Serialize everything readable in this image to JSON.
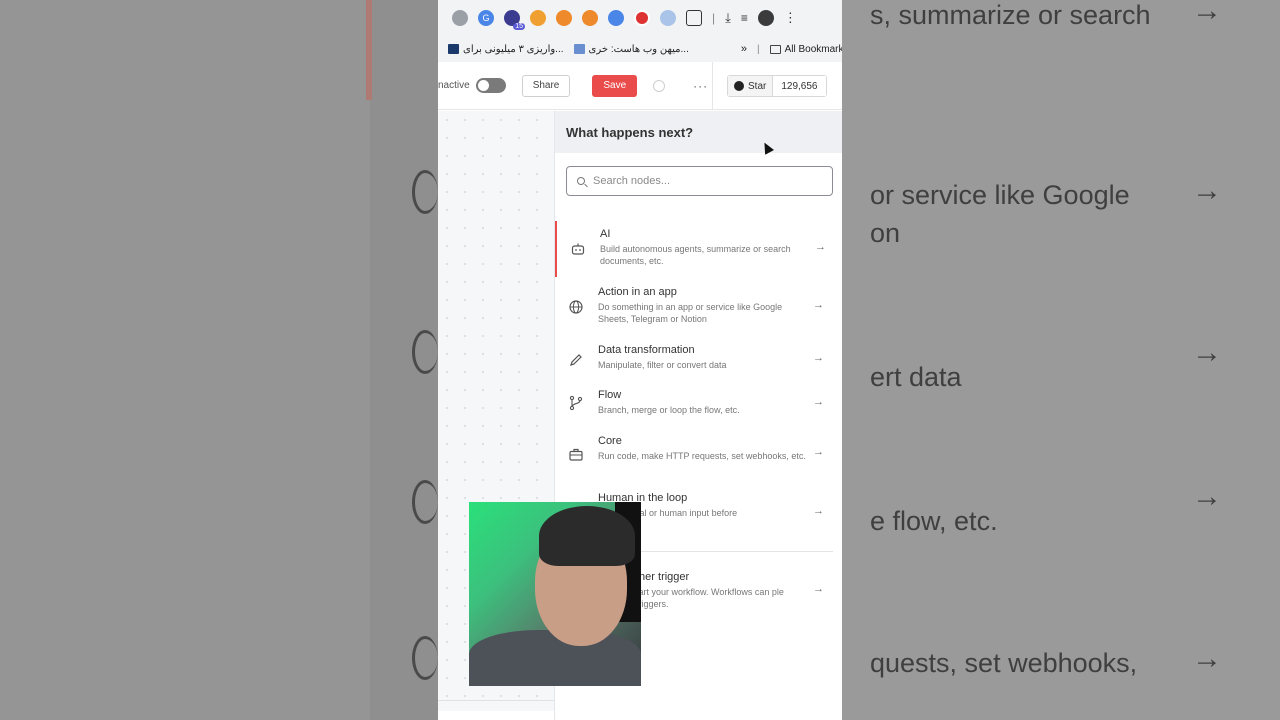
{
  "browser": {
    "extensions": [
      "camera-icon",
      "translate-icon",
      "grad-cap-icon",
      "rss-icon",
      "pocket-icon",
      "pocket-icon",
      "tool-icon",
      "globe-badge-icon",
      "shield-icon",
      "puzzle-icon"
    ],
    "ext_badge": "15",
    "bookmarks": [
      {
        "label": "واریزی ۳ میلیونی برای..."
      },
      {
        "label": "میهن وب هاست: خری..."
      }
    ],
    "more_bookmarks": "»",
    "all_bookmarks": "All Bookmarks"
  },
  "toolbar": {
    "inactive_label": "nactive",
    "share_label": "Share",
    "save_label": "Save",
    "more_label": "···",
    "github_star": "Star",
    "github_count": "129,656"
  },
  "panel": {
    "title": "What happens next?",
    "search_placeholder": "Search nodes...",
    "items": [
      {
        "title": "AI",
        "desc": "Build autonomous agents, summarize or search documents, etc.",
        "icon": "robot-icon"
      },
      {
        "title": "Action in an app",
        "desc": "Do something in an app or service like Google Sheets, Telegram or Notion",
        "icon": "globe-icon"
      },
      {
        "title": "Data transformation",
        "desc": "Manipulate, filter or convert data",
        "icon": "pencil-icon"
      },
      {
        "title": "Flow",
        "desc": "Branch, merge or loop the flow, etc.",
        "icon": "branch-icon"
      },
      {
        "title": "Core",
        "desc": "Run code, make HTTP requests, set webhooks, etc.",
        "icon": "toolbox-icon"
      },
      {
        "title": "Human in the loop",
        "desc": "approval or human input before",
        "icon": "user-icon"
      },
      {
        "title": "ther trigger",
        "desc": "tart your workflow. Workflows can ple triggers.",
        "icon": "bolt-icon"
      }
    ]
  },
  "background": {
    "ghost_lines": [
      "s, summarize or search",
      "or service like Google",
      "on",
      "ert data",
      "e flow, etc.",
      "quests, set webhooks,"
    ]
  },
  "colors": {
    "accent": "#ea4b4b",
    "panel_header": "#eef0f4"
  }
}
